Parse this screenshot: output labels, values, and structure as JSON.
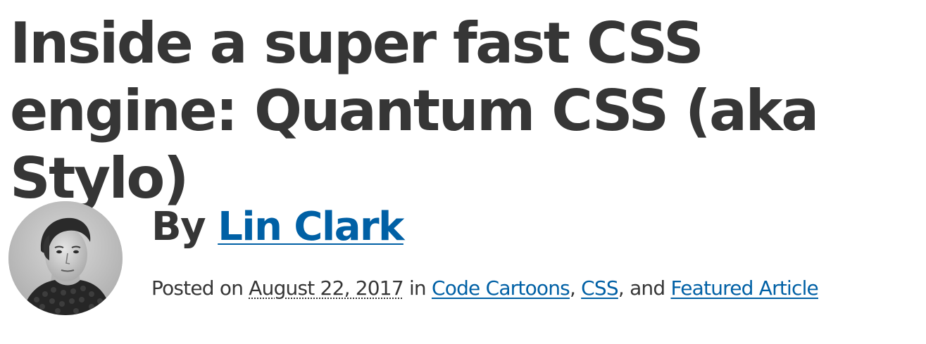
{
  "article": {
    "title": "Inside a super fast CSS engine: Quantum CSS (aka Stylo)"
  },
  "byline": {
    "by_prefix": "By ",
    "author_name": "Lin Clark",
    "posted_on_prefix": "Posted on ",
    "date": "August 22, 2017",
    "in_word": " in ",
    "categories": [
      "Code Cartoons",
      "CSS",
      "Featured Article"
    ],
    "separator": ", ",
    "and_word": ", and "
  },
  "colors": {
    "text": "#363636",
    "link": "#0060a5",
    "background": "#ffffff"
  },
  "icons": {
    "avatar": "author-avatar-photo"
  }
}
